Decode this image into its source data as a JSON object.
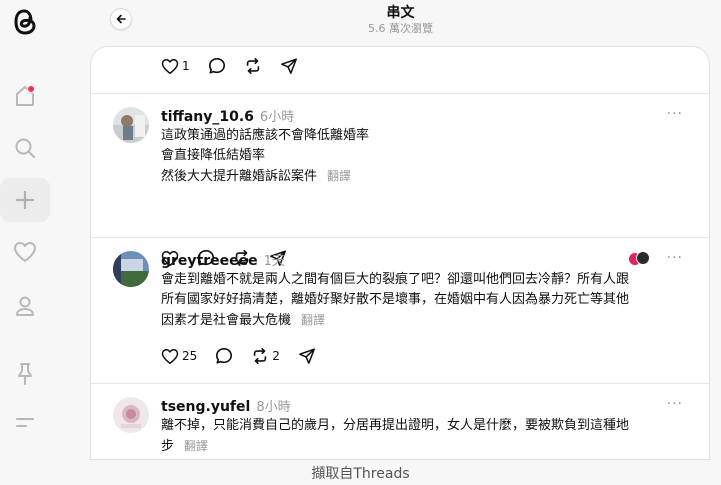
{
  "header": {
    "title": "串文",
    "subtitle": "5.6 萬次瀏覽"
  },
  "top_actions": {
    "like_count": "1"
  },
  "posts": [
    {
      "username": "tiffany_10.6",
      "time": "6小時",
      "lines": [
        "這政策通過的話應該不會降低離婚率",
        "會直接降低結婚率",
        "然後大大提升離婚訴訟案件"
      ],
      "translate": "翻譯",
      "like_count": "",
      "repost_count": ""
    },
    {
      "username": "greytreeeee",
      "time": "1天",
      "lines": [
        "會走到離婚不就是兩人之間有個巨大的裂痕了吧？卻還叫他們回去冷靜？所有人跟",
        "所有國家好好搞清楚，離婚好聚好散不是壞事，在婚姻中有人因為暴力死亡等其他",
        "因素才是社會最大危機"
      ],
      "translate": "翻譯",
      "like_count": "25",
      "repost_count": "2"
    },
    {
      "username": "tseng.yufel",
      "time": "8小時",
      "lines": [
        "離不掉，只能消費自己的歲月，分居再提出證明，女人是什麼，要被欺負到這種地",
        "步"
      ],
      "translate": "翻譯"
    }
  ],
  "caption": "擷取自Threads",
  "colors": {
    "notification": "#ff2d55",
    "muted": "#999999",
    "text": "#101010"
  },
  "icons": [
    "threads-logo-icon",
    "home-icon",
    "search-icon",
    "plus-icon",
    "heart-icon",
    "profile-icon",
    "pin-icon",
    "menu-icon",
    "back-arrow-icon",
    "comment-icon",
    "repost-icon",
    "share-icon",
    "more-icon"
  ]
}
